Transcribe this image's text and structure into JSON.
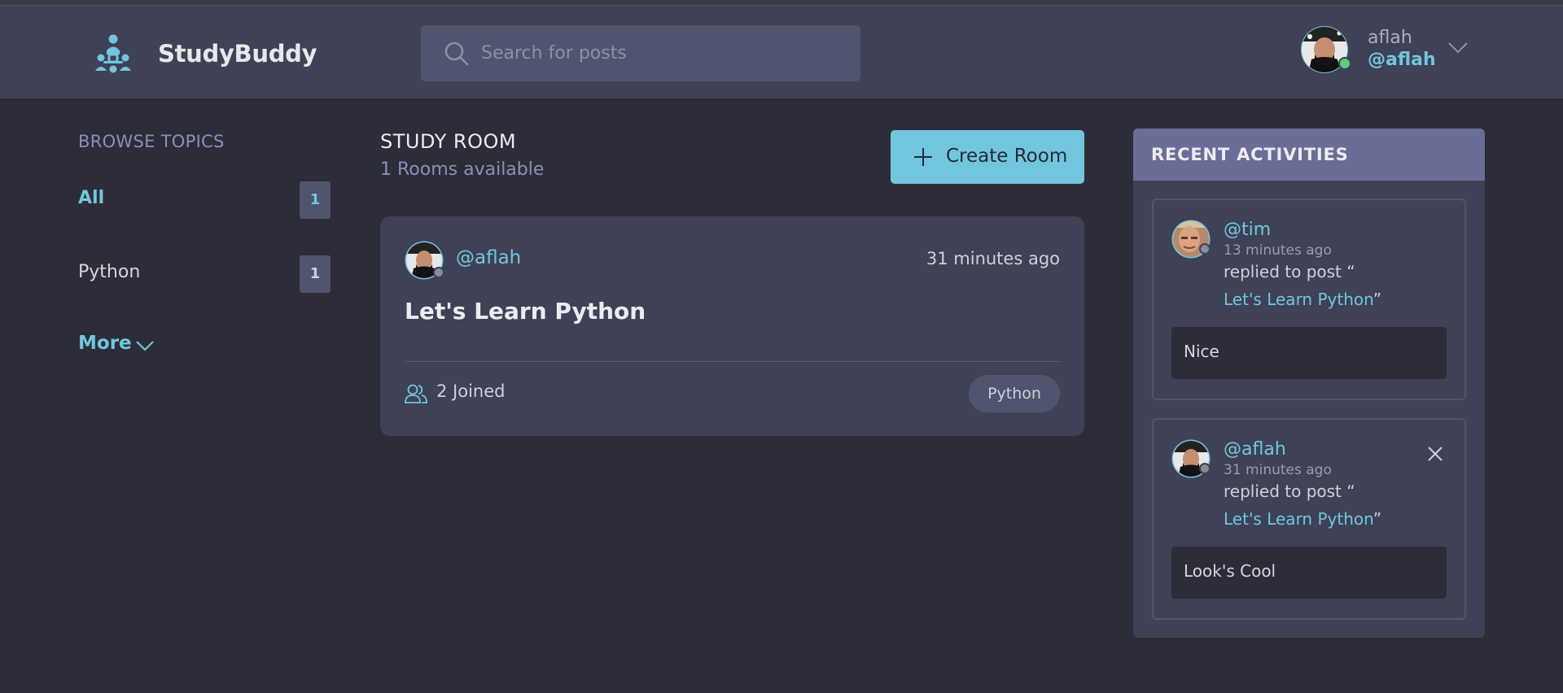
{
  "app": {
    "name": "StudyBuddy"
  },
  "search": {
    "placeholder": "Search for posts",
    "value": ""
  },
  "user": {
    "name": "aflah",
    "handle": "@aflah",
    "status": "online"
  },
  "sidebar": {
    "title": "BROWSE TOPICS",
    "topics": [
      {
        "label": "All",
        "count": "1",
        "active": true
      },
      {
        "label": "Python",
        "count": "1",
        "active": false
      }
    ],
    "more_label": "More"
  },
  "main": {
    "heading": "STUDY ROOM",
    "subheading": "1 Rooms available",
    "create_label": "Create Room",
    "rooms": [
      {
        "host": "@aflah",
        "time": "31 minutes ago",
        "title": "Let's Learn Python",
        "joined": "2 Joined",
        "topic": "Python"
      }
    ]
  },
  "activities": {
    "title": "RECENT ACTIVITIES",
    "items": [
      {
        "user": "@tim",
        "time": "13 minutes ago",
        "action": "replied to post “",
        "post": "Let's Learn Python",
        "post_suffix": "”",
        "message": "Nice",
        "deletable": false
      },
      {
        "user": "@aflah",
        "time": "31 minutes ago",
        "action": "replied to post “",
        "post": "Let's Learn Python",
        "post_suffix": "”",
        "message": "Look's Cool",
        "deletable": true
      }
    ]
  },
  "colors": {
    "accent": "#71c6dd",
    "background": "#2d2d39",
    "surface": "#3f4156",
    "panel_header": "#696d97",
    "online": "#5cd07a"
  }
}
